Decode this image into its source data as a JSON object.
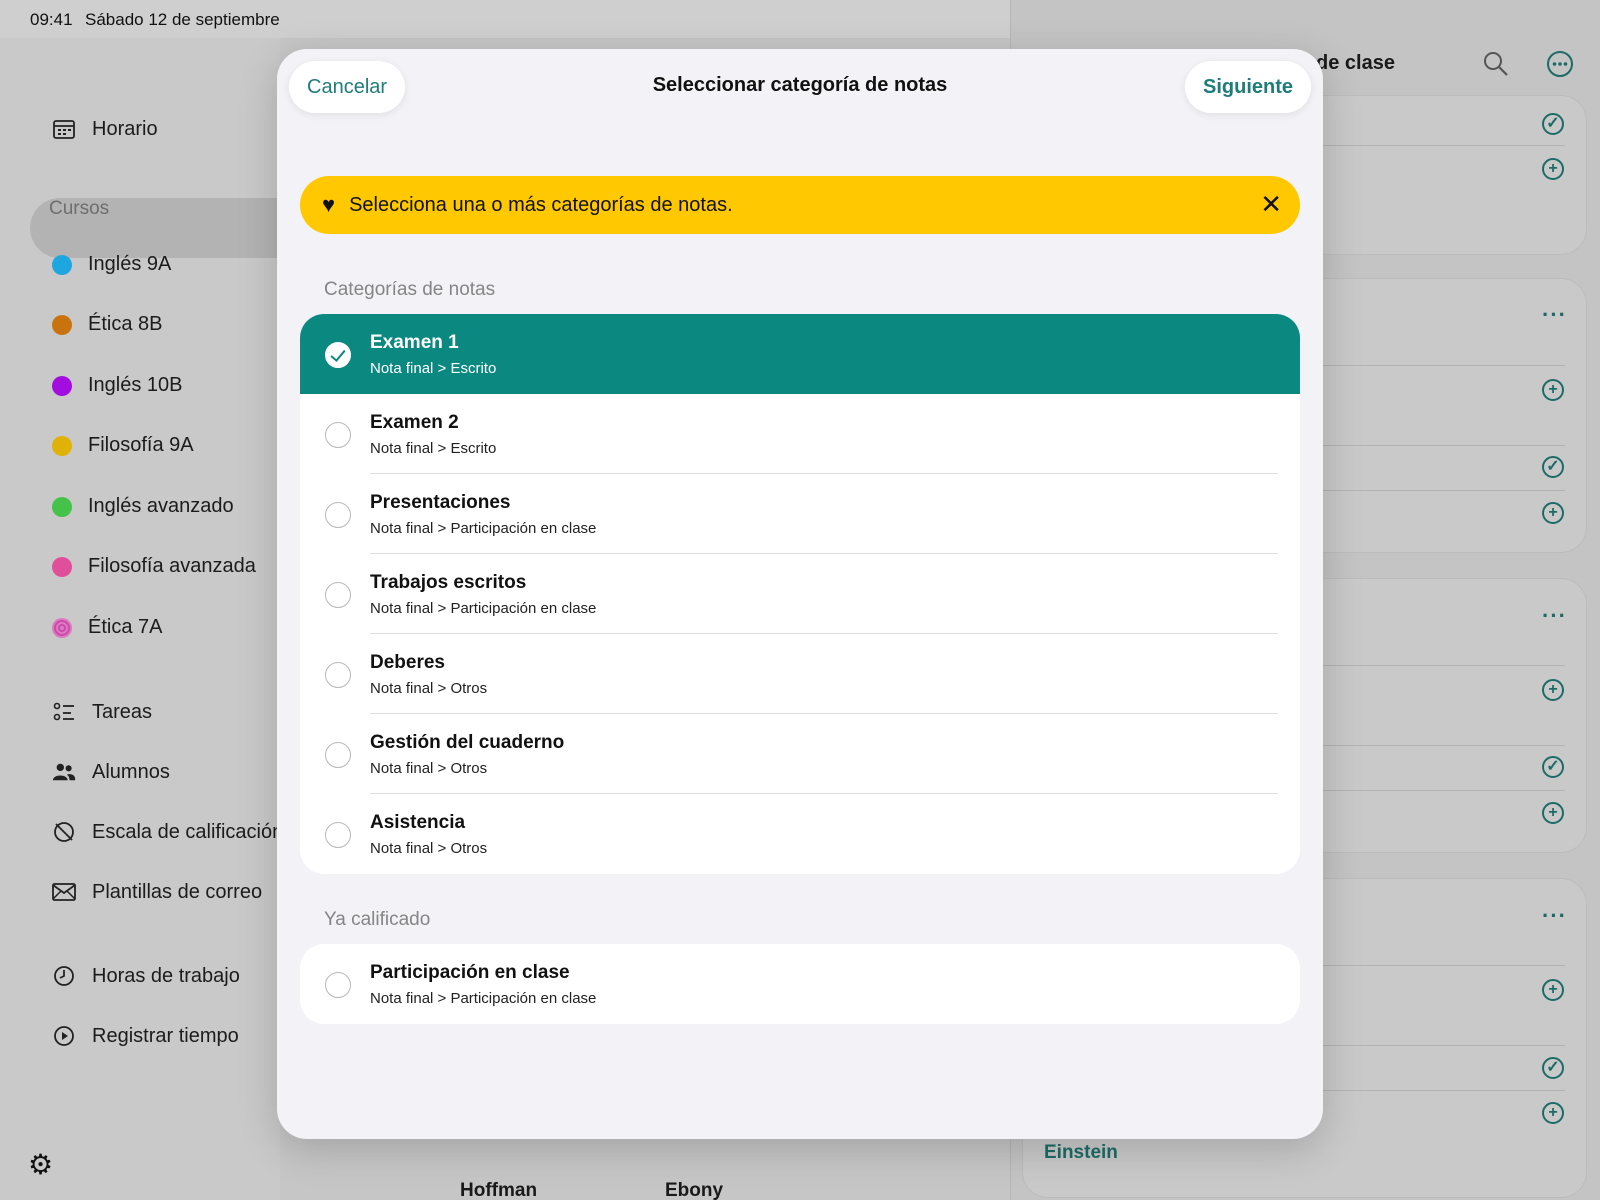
{
  "status_bar": {
    "time": "09:41",
    "date": "Sábado 12 de septiembre"
  },
  "sidebar": {
    "schedule_label": "Horario",
    "courses_header": "Cursos",
    "courses": [
      {
        "label": "Inglés 9A",
        "color": "#1ea6e0"
      },
      {
        "label": "Ética 8B",
        "color": "#c9730f"
      },
      {
        "label": "Inglés 10B",
        "color": "#a30ee0"
      },
      {
        "label": "Filosofía 9A",
        "color": "#e0b208"
      },
      {
        "label": "Inglés avanzado",
        "color": "#44c24a"
      },
      {
        "label": "Filosofía avanzada",
        "color": "#e0509a"
      },
      {
        "label": "Ética 7A",
        "color": "#e077c4"
      }
    ],
    "tools": [
      {
        "label": "Tareas",
        "icon": "checklist-icon"
      },
      {
        "label": "Alumnos",
        "icon": "people-icon"
      },
      {
        "label": "Escala de calificación",
        "icon": "scale-icon"
      },
      {
        "label": "Plantillas de correo",
        "icon": "envelope-icon"
      }
    ],
    "time_tools": [
      {
        "label": "Horas de trabajo",
        "icon": "clock-icon"
      },
      {
        "label": "Registrar tiempo",
        "icon": "play-icon"
      }
    ]
  },
  "background": {
    "right_header_partial": "de clase",
    "bottom_names": [
      "Hoffman",
      "Ebony"
    ],
    "right_bottom_name": "Einstein"
  },
  "modal": {
    "title": "Seleccionar categoría de notas",
    "cancel_label": "Cancelar",
    "next_label": "Siguiente",
    "banner_text": "Selecciona una o más categorías de notas.",
    "grade_categories_header": "Categorías de notas",
    "grade_categories": [
      {
        "name": "Examen 1",
        "path": "Nota final > Escrito",
        "selected": true
      },
      {
        "name": "Examen 2",
        "path": "Nota final > Escrito",
        "selected": false
      },
      {
        "name": "Presentaciones",
        "path": "Nota final > Participación en clase",
        "selected": false
      },
      {
        "name": "Trabajos escritos",
        "path": "Nota final > Participación en clase",
        "selected": false
      },
      {
        "name": "Deberes",
        "path": "Nota final > Otros",
        "selected": false
      },
      {
        "name": "Gestión del cuaderno",
        "path": "Nota final > Otros",
        "selected": false
      },
      {
        "name": "Asistencia",
        "path": "Nota final > Otros",
        "selected": false
      }
    ],
    "already_graded_header": "Ya calificado",
    "already_graded": [
      {
        "name": "Participación en clase",
        "path": "Nota final > Participación en clase",
        "selected": false
      }
    ]
  },
  "colors": {
    "accent": "#0b8880",
    "banner": "#ffc800",
    "link": "#1e7d78"
  }
}
